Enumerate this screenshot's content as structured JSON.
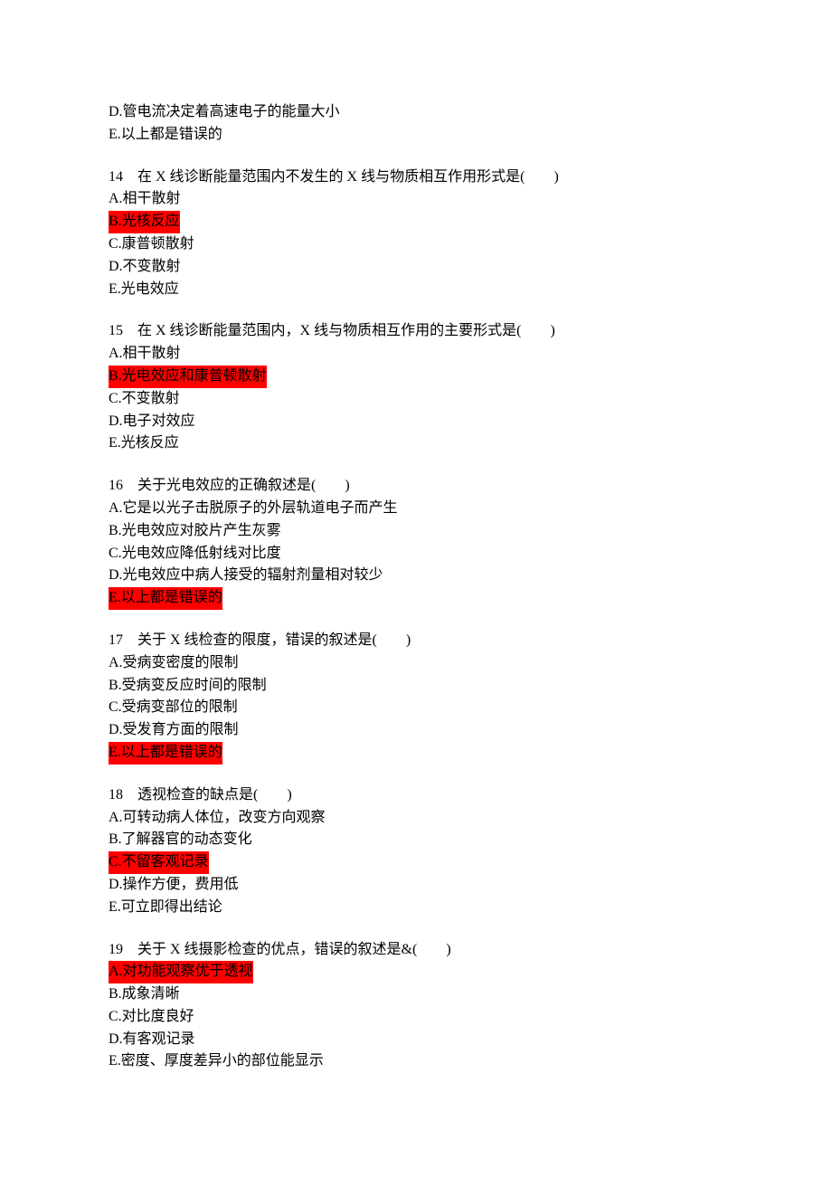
{
  "leadin": [
    "D.管电流决定着高速电子的能量大小",
    "E.以上都是错误的"
  ],
  "questions": [
    {
      "stem": "14　在 X 线诊断能量范围内不发生的 X 线与物质相互作用形式是(　　)",
      "options": [
        {
          "text": "A.相干散射",
          "highlight": false
        },
        {
          "text": "B.光核反应",
          "highlight": true
        },
        {
          "text": "C.康普顿散射",
          "highlight": false
        },
        {
          "text": "D.不变散射",
          "highlight": false
        },
        {
          "text": "E.光电效应",
          "highlight": false
        }
      ]
    },
    {
      "stem": "15　在 X 线诊断能量范围内，X 线与物质相互作用的主要形式是(　　)",
      "options": [
        {
          "text": "A.相干散射",
          "highlight": false
        },
        {
          "text": "B.光电效应和康普顿散射",
          "highlight": true
        },
        {
          "text": "C.不变散射",
          "highlight": false
        },
        {
          "text": "D.电子对效应",
          "highlight": false
        },
        {
          "text": "E.光核反应",
          "highlight": false
        }
      ]
    },
    {
      "stem": "16　关于光电效应的正确叙述是(　　)",
      "options": [
        {
          "text": "A.它是以光子击脱原子的外层轨道电子而产生",
          "highlight": false
        },
        {
          "text": "B.光电效应对胶片产生灰雾",
          "highlight": false
        },
        {
          "text": "C.光电效应降低射线对比度",
          "highlight": false
        },
        {
          "text": "D.光电效应中病人接受的辐射剂量相对较少",
          "highlight": false
        },
        {
          "text": "E.以上都是错误的",
          "highlight": true
        }
      ]
    },
    {
      "stem": "17　关于 X 线检查的限度，错误的叙述是(　　)",
      "options": [
        {
          "text": "A.受病变密度的限制",
          "highlight": false
        },
        {
          "text": "B.受病变反应时间的限制",
          "highlight": false
        },
        {
          "text": "C.受病变部位的限制",
          "highlight": false
        },
        {
          "text": "D.受发育方面的限制",
          "highlight": false
        },
        {
          "text": "E.以上都是错误的",
          "highlight": true
        }
      ]
    },
    {
      "stem": "18　透视检查的缺点是(　　)",
      "options": [
        {
          "text": "A.可转动病人体位，改变方向观察",
          "highlight": false
        },
        {
          "text": "B.了解器官的动态变化",
          "highlight": false
        },
        {
          "text": "C.不留客观记录",
          "highlight": true
        },
        {
          "text": "D.操作方便，费用低",
          "highlight": false
        },
        {
          "text": "E.可立即得出结论",
          "highlight": false
        }
      ]
    },
    {
      "stem": "19　关于 X 线摄影检查的优点，错误的叙述是&(　　)",
      "options": [
        {
          "text": "A.对功能观察优于透视",
          "highlight": true
        },
        {
          "text": "B.成象清晰",
          "highlight": false
        },
        {
          "text": "C.对比度良好",
          "highlight": false
        },
        {
          "text": "D.有客观记录",
          "highlight": false
        },
        {
          "text": "E.密度、厚度差异小的部位能显示",
          "highlight": false
        }
      ]
    }
  ]
}
